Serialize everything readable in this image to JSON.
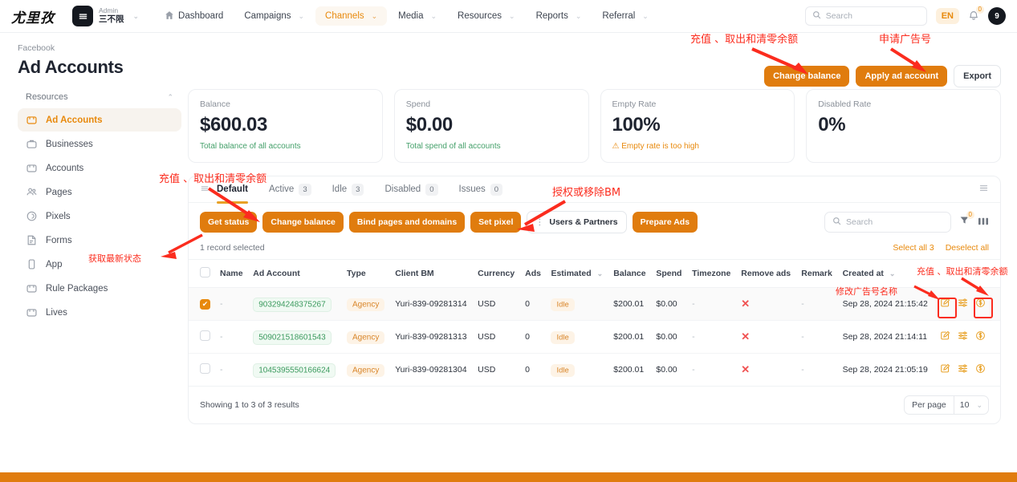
{
  "topnav": {
    "brand": "尤里孜",
    "org": {
      "role": "Admin",
      "name": "三不限"
    },
    "items": [
      {
        "label": "Dashboard",
        "icon": "home-icon",
        "caret": false,
        "active": false
      },
      {
        "label": "Campaigns",
        "icon": "",
        "caret": true,
        "active": false
      },
      {
        "label": "Channels",
        "icon": "",
        "caret": true,
        "active": true
      },
      {
        "label": "Media",
        "icon": "",
        "caret": true,
        "active": false
      },
      {
        "label": "Resources",
        "icon": "",
        "caret": true,
        "active": false
      },
      {
        "label": "Reports",
        "icon": "",
        "caret": true,
        "active": false
      },
      {
        "label": "Referral",
        "icon": "",
        "caret": true,
        "active": false
      }
    ],
    "search_placeholder": "Search",
    "lang": "EN",
    "notif_count": "0",
    "avatar": "9"
  },
  "page": {
    "breadcrumb": "Facebook",
    "title": "Ad Accounts",
    "actions": {
      "change_balance": "Change balance",
      "apply_ad_account": "Apply ad account",
      "export": "Export"
    }
  },
  "sidebar": {
    "group_label": "Resources",
    "items": [
      {
        "label": "Ad Accounts",
        "icon": "box-icon",
        "active": true
      },
      {
        "label": "Businesses",
        "icon": "briefcase-icon",
        "active": false
      },
      {
        "label": "Accounts",
        "icon": "box-icon",
        "active": false
      },
      {
        "label": "Pages",
        "icon": "people-icon",
        "active": false
      },
      {
        "label": "Pixels",
        "icon": "pixel-icon",
        "active": false
      },
      {
        "label": "Forms",
        "icon": "form-icon",
        "active": false
      },
      {
        "label": "App",
        "icon": "phone-icon",
        "active": false
      },
      {
        "label": "Rule Packages",
        "icon": "box-icon",
        "active": false
      },
      {
        "label": "Lives",
        "icon": "box-icon",
        "active": false
      }
    ]
  },
  "cards": [
    {
      "label": "Balance",
      "value": "$600.03",
      "sub": "Total balance of all accounts",
      "warn": false
    },
    {
      "label": "Spend",
      "value": "$0.00",
      "sub": "Total spend of all accounts",
      "warn": false
    },
    {
      "label": "Empty Rate",
      "value": "100%",
      "sub": "Empty rate is too high",
      "warn": true
    },
    {
      "label": "Disabled Rate",
      "value": "0%",
      "sub": "",
      "warn": false
    }
  ],
  "tabs": [
    {
      "label": "Default",
      "count": "",
      "active": true
    },
    {
      "label": "Active",
      "count": "3",
      "active": false
    },
    {
      "label": "Idle",
      "count": "3",
      "active": false
    },
    {
      "label": "Disabled",
      "count": "0",
      "active": false
    },
    {
      "label": "Issues",
      "count": "0",
      "active": false
    }
  ],
  "toolbar": {
    "get_status": "Get status",
    "change_balance": "Change balance",
    "bind_pages": "Bind pages and domains",
    "set_pixel": "Set pixel",
    "users_partners": "Users & Partners",
    "prepare_ads": "Prepare Ads",
    "search_placeholder": "Search",
    "filter_badge": "0"
  },
  "selection": {
    "text": "1 record selected",
    "select_all": "Select all 3",
    "deselect_all": "Deselect all"
  },
  "table": {
    "columns": [
      "Name",
      "Ad Account",
      "Type",
      "Client BM",
      "Currency",
      "Ads",
      "Estimated",
      "Balance",
      "Spend",
      "Timezone",
      "Remove ads",
      "Remark",
      "Created at"
    ],
    "rows": [
      {
        "checked": true,
        "name": "-",
        "ad_account": "903294248375267",
        "type": "Agency",
        "client_bm": "Yuri-839-09281314",
        "currency": "USD",
        "ads": "0",
        "estimated": "Idle",
        "balance": "$200.01",
        "spend": "$0.00",
        "timezone": "-",
        "remove_ads": "✕",
        "remark": "-",
        "created_at": "Sep 28, 2024 21:15:42"
      },
      {
        "checked": false,
        "name": "-",
        "ad_account": "509021518601543",
        "type": "Agency",
        "client_bm": "Yuri-839-09281313",
        "currency": "USD",
        "ads": "0",
        "estimated": "Idle",
        "balance": "$200.01",
        "spend": "$0.00",
        "timezone": "-",
        "remove_ads": "✕",
        "remark": "-",
        "created_at": "Sep 28, 2024 21:14:11"
      },
      {
        "checked": false,
        "name": "-",
        "ad_account": "1045395550166624",
        "type": "Agency",
        "client_bm": "Yuri-839-09281304",
        "currency": "USD",
        "ads": "0",
        "estimated": "Idle",
        "balance": "$200.01",
        "spend": "$0.00",
        "timezone": "-",
        "remove_ads": "✕",
        "remark": "-",
        "created_at": "Sep 28, 2024 21:05:19"
      }
    ]
  },
  "footer": {
    "results": "Showing 1 to 3 of 3 results",
    "per_page_label": "Per page",
    "per_page_value": "10"
  },
  "annotations": [
    {
      "id": "a1",
      "text": "充值 、取出和清零余额"
    },
    {
      "id": "a2",
      "text": "申请广告号"
    },
    {
      "id": "a3",
      "text": "充值 、取出和清零余额"
    },
    {
      "id": "a4",
      "text": "授权或移除BM"
    },
    {
      "id": "a5",
      "text": "获取最新状态"
    },
    {
      "id": "a6",
      "text": "充值 、取出和清零余额"
    },
    {
      "id": "a7",
      "text": "修改广告号名称"
    }
  ],
  "colors": {
    "accent": "#e07c0e",
    "annotation": "#fb2c1e",
    "success": "#3b9a5e",
    "danger": "#f05252"
  }
}
